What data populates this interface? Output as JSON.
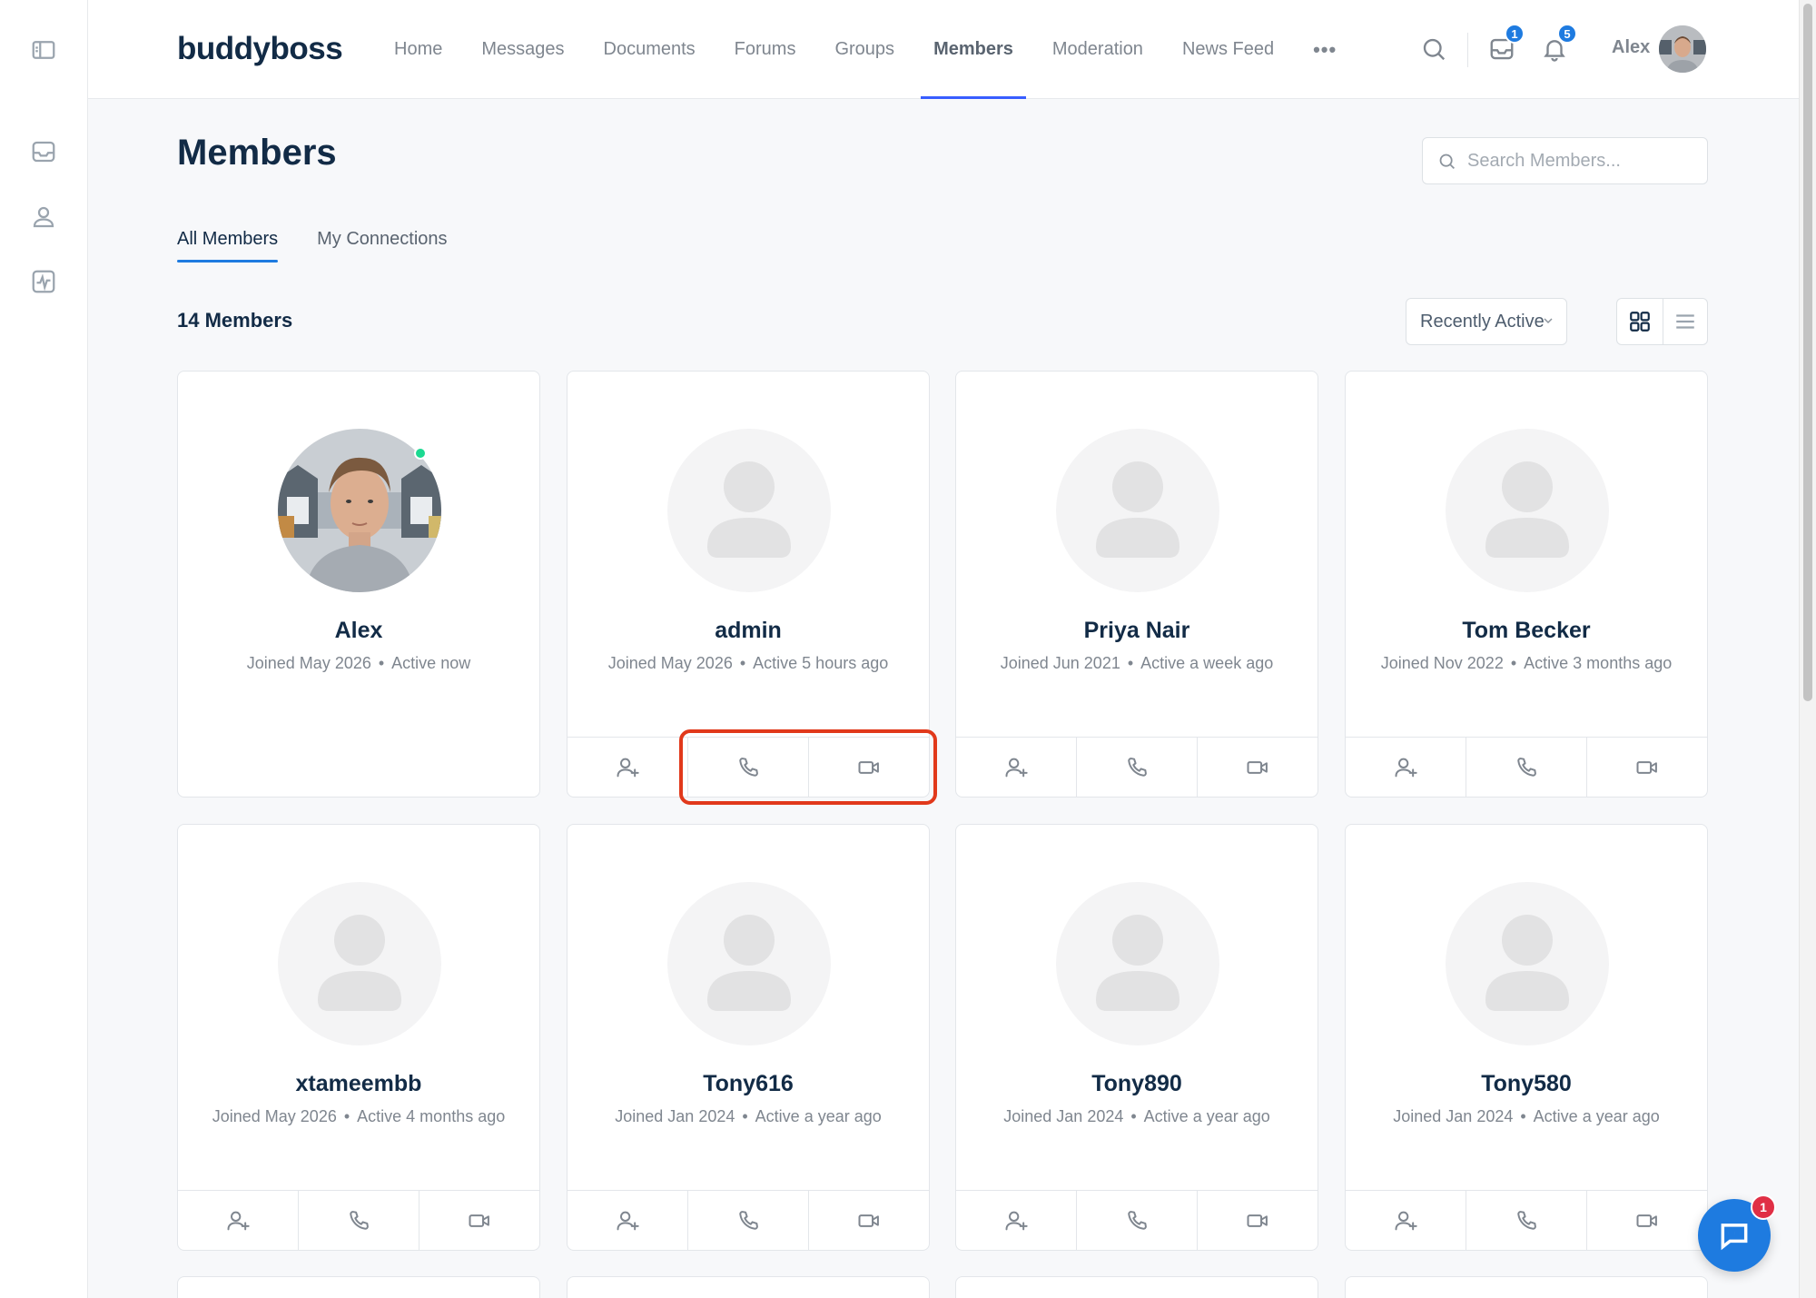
{
  "sidebar": {
    "items": [
      {
        "icon": "sidebar-toggle-icon"
      },
      {
        "icon": "inbox-icon"
      },
      {
        "icon": "user-icon"
      },
      {
        "icon": "activity-icon"
      }
    ]
  },
  "header": {
    "logo": "buddyboss",
    "nav": [
      "Home",
      "Messages",
      "Documents",
      "Forums",
      "Groups",
      "Members",
      "Moderation",
      "News Feed"
    ],
    "active_nav": "Members",
    "more": "•••",
    "messages_badge": "1",
    "notifications_badge": "5",
    "user_name": "Alex"
  },
  "page": {
    "title": "Members",
    "search_placeholder": "Search Members...",
    "tabs": [
      "All Members",
      "My Connections"
    ],
    "active_tab": "All Members",
    "count": "14 Members",
    "sort_value": "Recently Active",
    "view_mode": "grid"
  },
  "members": [
    {
      "name": "Alex",
      "joined": "Joined May 2026",
      "active": "Active now",
      "online": true,
      "photo": true,
      "actions": false
    },
    {
      "name": "admin",
      "joined": "Joined May 2026",
      "active": "Active 5 hours ago",
      "online": false,
      "photo": false,
      "actions": true
    },
    {
      "name": "Priya Nair",
      "joined": "Joined Jun 2021",
      "active": "Active a week ago",
      "online": false,
      "photo": false,
      "actions": true
    },
    {
      "name": "Tom Becker",
      "joined": "Joined Nov 2022",
      "active": "Active 3 months ago",
      "online": false,
      "photo": false,
      "actions": true
    },
    {
      "name": "xtameembb",
      "joined": "Joined May 2026",
      "active": "Active 4 months ago",
      "online": false,
      "photo": false,
      "actions": true
    },
    {
      "name": "Tony616",
      "joined": "Joined Jan 2024",
      "active": "Active a year ago",
      "online": false,
      "photo": false,
      "actions": true
    },
    {
      "name": "Tony890",
      "joined": "Joined Jan 2024",
      "active": "Active a year ago",
      "online": false,
      "photo": false,
      "actions": true
    },
    {
      "name": "Tony580",
      "joined": "Joined Jan 2024",
      "active": "Active a year ago",
      "online": false,
      "photo": false,
      "actions": true
    }
  ],
  "card_action_icons": [
    "add-connection-icon",
    "phone-icon",
    "video-icon"
  ],
  "chat": {
    "badge": "1"
  },
  "colors": {
    "accent": "#1e7be0",
    "nav_underline": "#385dff",
    "text_dark": "#122b46",
    "online": "#1cd991",
    "highlight": "#e1391b",
    "badge_red": "#e02f45"
  }
}
